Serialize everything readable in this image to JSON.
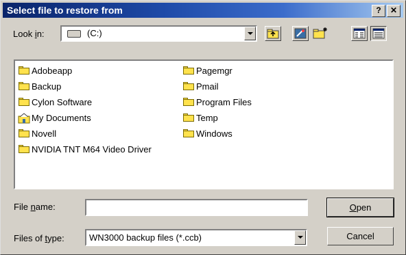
{
  "window": {
    "title": "Select file to restore from",
    "help_glyph": "?",
    "close_glyph": "✕"
  },
  "lookin": {
    "label_pre": "Look ",
    "label_key": "i",
    "label_post": "n:",
    "value": "(C:)",
    "drive_icon": "hard-drive-icon"
  },
  "toolbar": {
    "buttons": [
      {
        "name": "up-one-level-button",
        "icon": "up-folder-icon"
      },
      {
        "name": "go-to-desktop-button",
        "icon": "desktop-icon"
      },
      {
        "name": "create-new-folder-button",
        "icon": "new-folder-icon"
      },
      {
        "name": "list-view-button",
        "icon": "list-view-icon"
      },
      {
        "name": "details-view-button",
        "icon": "details-view-icon"
      }
    ]
  },
  "files": {
    "col1": [
      "Adobeapp",
      "Backup",
      "Cylon Software",
      "My Documents",
      "Novell",
      "NVIDIA TNT M64 Video Driver"
    ],
    "col2": [
      "Pagemgr",
      "Pmail",
      "Program Files",
      "Temp",
      "Windows"
    ]
  },
  "filename": {
    "label_pre": "File ",
    "label_key": "n",
    "label_post": "ame:",
    "value": ""
  },
  "filetype": {
    "label_pre": "Files of ",
    "label_key": "t",
    "label_post": "ype:",
    "value": "WN3000 backup files (*.ccb)"
  },
  "buttons": {
    "open_key": "O",
    "open_rest": "pen",
    "cancel": "Cancel"
  },
  "colors": {
    "title_bar": "#0a246a",
    "folder": "#ffe24d",
    "face": "#d4d0c8"
  }
}
